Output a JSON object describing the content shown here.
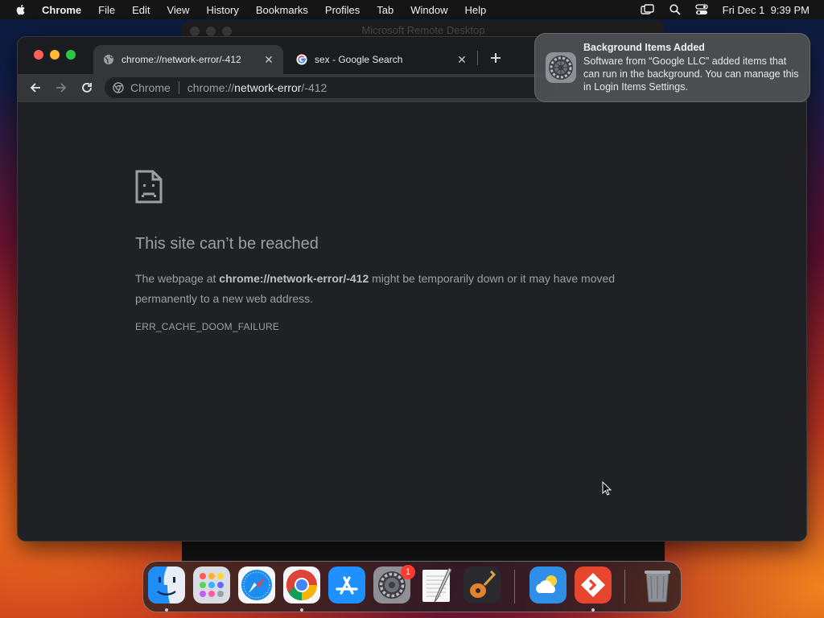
{
  "menubar": {
    "app_name": "Chrome",
    "items": [
      "File",
      "Edit",
      "View",
      "History",
      "Bookmarks",
      "Profiles",
      "Tab",
      "Window",
      "Help"
    ],
    "clock": "Fri Dec 1  9:39 PM"
  },
  "background_window": {
    "title": "Microsoft Remote Desktop"
  },
  "browser": {
    "tabs": [
      {
        "title": "chrome://network-error/-412",
        "active": true,
        "icon": "globe-icon"
      },
      {
        "title": "sex - Google Search",
        "active": false,
        "icon": "google-icon"
      }
    ],
    "omnibox": {
      "chip_label": "Chrome",
      "url_prefix": "chrome://",
      "url_host": "network-error",
      "url_suffix": "/-412"
    }
  },
  "error_page": {
    "title": "This site can’t be reached",
    "text_before": "The webpage at ",
    "url": "chrome://network-error/-412",
    "text_after": " might be temporarily down or it may have moved permanently to a new web address.",
    "code": "ERR_CACHE_DOOM_FAILURE"
  },
  "notification": {
    "title": "Background Items Added",
    "body": "Software from “Google LLC” added items that can run in the background. You can manage this in Login Items Settings.",
    "icon": "system-settings-icon"
  },
  "dock": {
    "apps": [
      "Finder",
      "Launchpad",
      "Safari",
      "Chrome",
      "App Store",
      "System Settings",
      "TextEdit",
      "GarageBand",
      "Weather",
      "Microsoft Remote Desktop",
      "Trash"
    ],
    "settings_badge": "1"
  },
  "colors": {
    "close": "#ff5f57",
    "minimize": "#febc2e",
    "zoom": "#28c840",
    "badge": "#ff3b30"
  }
}
